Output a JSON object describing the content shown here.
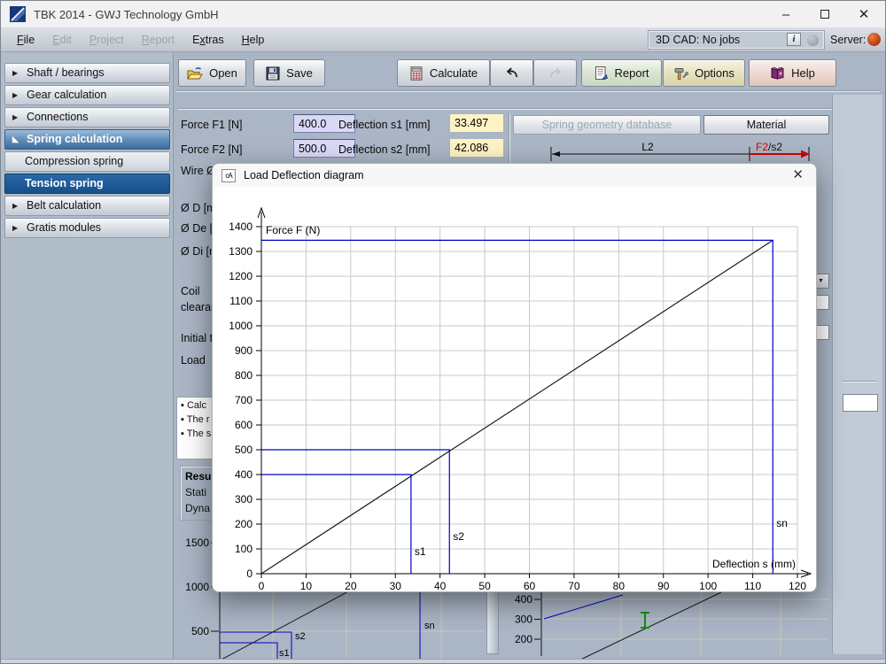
{
  "window": {
    "title": "TBK 2014 - GWJ Technology GmbH"
  },
  "menu": {
    "items": [
      {
        "label": "File",
        "hotkey": 0,
        "enabled": true
      },
      {
        "label": "Edit",
        "hotkey": 0,
        "enabled": false
      },
      {
        "label": "Project",
        "hotkey": 0,
        "enabled": false
      },
      {
        "label": "Report",
        "hotkey": 0,
        "enabled": false
      },
      {
        "label": "Extras",
        "hotkey": 1,
        "enabled": true
      },
      {
        "label": "Help",
        "hotkey": 0,
        "enabled": true
      }
    ],
    "cad_status": "3D CAD: No jobs",
    "info_button": "i",
    "server_label": "Server:",
    "server_dot_color": "#b03a10",
    "cad_dot_color": "#8d949b"
  },
  "sidebar": {
    "items": [
      {
        "label": "Shaft / bearings",
        "type": "group",
        "state": "collapsed"
      },
      {
        "label": "Gear calculation",
        "type": "group",
        "state": "collapsed"
      },
      {
        "label": "Connections",
        "type": "group",
        "state": "collapsed"
      },
      {
        "label": "Spring calculation",
        "type": "group",
        "state": "expanded"
      },
      {
        "label": "Compression spring",
        "type": "sub",
        "state": "normal"
      },
      {
        "label": "Tension spring",
        "type": "sub",
        "state": "selected"
      },
      {
        "label": "Belt calculation",
        "type": "group",
        "state": "collapsed"
      },
      {
        "label": "Gratis modules",
        "type": "group",
        "state": "collapsed"
      }
    ]
  },
  "toolbar": {
    "buttons": [
      {
        "label": "Open",
        "icon": "open-folder-icon",
        "tint": "default",
        "enabled": true
      },
      {
        "label": "Save",
        "icon": "save-floppy-icon",
        "tint": "default",
        "enabled": true
      },
      {
        "label": "Calculate",
        "icon": "calculator-icon",
        "tint": "default",
        "enabled": true
      },
      {
        "label": "",
        "icon": "undo-icon",
        "tint": "default",
        "enabled": true
      },
      {
        "label": "",
        "icon": "redo-icon",
        "tint": "default",
        "enabled": false
      },
      {
        "label": "Report",
        "icon": "report-doc-icon",
        "tint": "green",
        "enabled": true
      },
      {
        "label": "Options",
        "icon": "options-tools-icon",
        "tint": "yellow",
        "enabled": true
      },
      {
        "label": "Help",
        "icon": "help-book-icon",
        "tint": "red",
        "enabled": true
      }
    ]
  },
  "form": {
    "f1_label": "Force F1 [N]",
    "f1_value": "400.0",
    "s1_label": "Deflection s1 [mm]",
    "s1_value": "33.497",
    "f2_label": "Force F2 [N]",
    "f2_value": "500.0",
    "s2_label": "Deflection s2 [mm]",
    "s2_value": "42.086",
    "geometry_button": "Spring geometry database",
    "material_button": "Material",
    "drawing": {
      "dim_label": "L2",
      "force_label_red": "F2",
      "force_label_suffix": "/s2",
      "red": "#d00000"
    }
  },
  "background": {
    "left_labels": [
      "Wire Ø",
      "Ø D [m",
      "Ø De [r",
      "Ø Di [n",
      "Coil",
      "clearan",
      "Initial t",
      "Load"
    ],
    "notes": [
      "Calc",
      "The r",
      "The s"
    ],
    "results_title": "Resu",
    "results_rows": [
      "Stati",
      "Dyna"
    ],
    "mini_left_ylabels": [
      "1500",
      "1000",
      "500"
    ],
    "mini_left_marks": {
      "s2": "s2",
      "s1": "s1",
      "sn": "sn"
    },
    "mini_right_ylabels": [
      "400",
      "300",
      "200"
    ],
    "marker_blue": "#0000c8",
    "marker_green": "#0f8f0f"
  },
  "dialog": {
    "title": "Load Deflection diagram",
    "icon_glyph": "cA",
    "close_glyph": "✕"
  },
  "chart_data": {
    "type": "line",
    "title": "Load Deflection diagram",
    "xlabel": "Deflection s (mm)",
    "ylabel": "Force F (N)",
    "xlim": [
      0,
      120
    ],
    "ylim": [
      0,
      1400
    ],
    "xticks": [
      0,
      10,
      20,
      30,
      40,
      50,
      60,
      70,
      80,
      90,
      100,
      110,
      120
    ],
    "yticks": [
      0,
      100,
      200,
      300,
      400,
      500,
      600,
      700,
      800,
      900,
      1000,
      1100,
      1200,
      1300,
      1400
    ],
    "grid": true,
    "series": [
      {
        "name": "spring-characteristic",
        "color": "#1a1a1a",
        "points": [
          [
            0,
            0
          ],
          [
            114.5,
            1345
          ]
        ]
      },
      {
        "name": "marker-F1-s1",
        "color": "#0000c8",
        "points": [
          [
            0,
            400
          ],
          [
            33.5,
            400
          ],
          [
            33.5,
            0
          ]
        ]
      },
      {
        "name": "marker-F2-s2",
        "color": "#0000c8",
        "points": [
          [
            0,
            500
          ],
          [
            42.1,
            500
          ],
          [
            42.1,
            0
          ]
        ]
      },
      {
        "name": "marker-Fn-sn",
        "color": "#0000c8",
        "points": [
          [
            0,
            1345
          ],
          [
            114.5,
            1345
          ],
          [
            114.5,
            0
          ]
        ]
      }
    ],
    "annotations": [
      {
        "text": "s1",
        "x": 34.3,
        "y": 75
      },
      {
        "text": "s2",
        "x": 42.9,
        "y": 135
      },
      {
        "text": "sn",
        "x": 115.3,
        "y": 190
      }
    ]
  }
}
